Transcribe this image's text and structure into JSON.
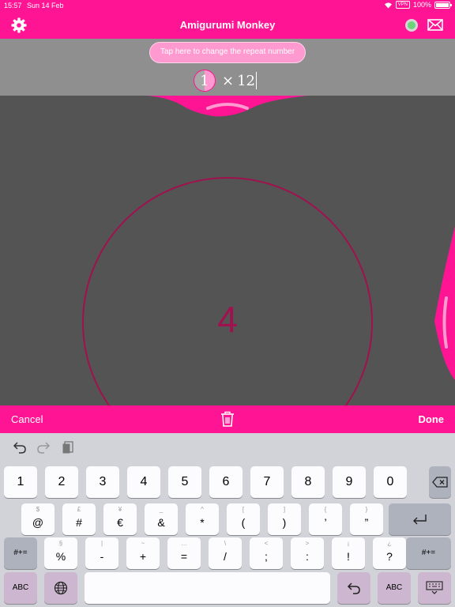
{
  "status_bar": {
    "time": "15:57",
    "date": "Sun 14 Feb",
    "vpn": "VPN",
    "battery": "100%"
  },
  "nav": {
    "title": "Amigurumi Monkey",
    "icons": [
      "gear-icon",
      "sync-status-icon",
      "mail-icon"
    ],
    "accent": "#ff1493"
  },
  "repeat": {
    "button_label": "Tap here to change the repeat number",
    "current": "1",
    "times": "×",
    "total": "12"
  },
  "canvas": {
    "stitch_number": "4"
  },
  "actions": {
    "cancel": "Cancel",
    "done": "Done"
  },
  "keyboard": {
    "row1": [
      "1",
      "2",
      "3",
      "4",
      "5",
      "6",
      "7",
      "8",
      "9",
      "0"
    ],
    "row2": [
      {
        "sub": "$",
        "main": "@"
      },
      {
        "sub": "£",
        "main": "#"
      },
      {
        "sub": "¥",
        "main": "€"
      },
      {
        "sub": "_",
        "main": "&"
      },
      {
        "sub": "^",
        "main": "*"
      },
      {
        "sub": "[",
        "main": "("
      },
      {
        "sub": "]",
        "main": ")"
      },
      {
        "sub": "{",
        "main": "’"
      },
      {
        "sub": "}",
        "main": "”"
      }
    ],
    "row3": [
      {
        "sub": "§",
        "main": "%"
      },
      {
        "sub": "|",
        "main": "-"
      },
      {
        "sub": "~",
        "main": "+"
      },
      {
        "sub": "…",
        "main": "="
      },
      {
        "sub": "\\",
        "main": "/"
      },
      {
        "sub": "<",
        "main": ";"
      },
      {
        "sub": ">",
        "main": ":"
      },
      {
        "sub": "¡",
        "main": "!"
      },
      {
        "sub": "¿",
        "main": "?"
      }
    ],
    "shift_label": "#+=",
    "abc_label": "ABC"
  }
}
